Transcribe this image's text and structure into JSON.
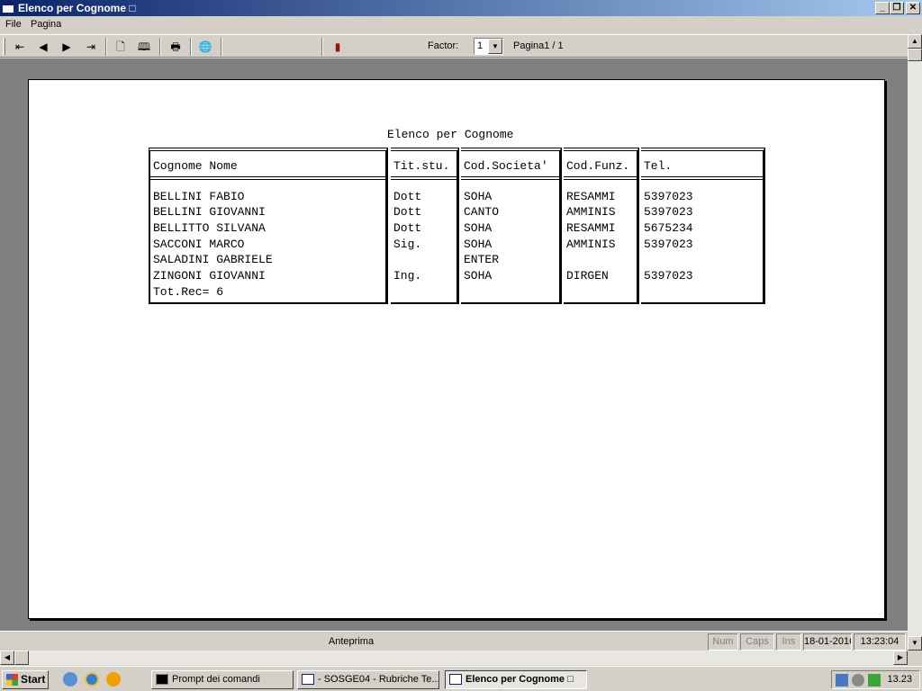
{
  "window": {
    "title": "Elenco per Cognome □"
  },
  "menu": [
    "File",
    "Pagina"
  ],
  "toolbar": {
    "factor_label": "Factor:",
    "factor_value": "1",
    "page_label": "Pagina1 / 1"
  },
  "report": {
    "title": "Elenco per Cognome",
    "columns": [
      "Cognome Nome",
      "Tit.stu.",
      "Cod.Societa'",
      "Cod.Funz.",
      "Tel."
    ],
    "rows": [
      [
        "BELLINI FABIO",
        "Dott",
        "SOHA",
        "RESAMMI",
        "5397023"
      ],
      [
        "BELLINI GIOVANNI",
        "Dott",
        "CANTO",
        "AMMINIS",
        "5397023"
      ],
      [
        "BELLITTO SILVANA",
        "Dott",
        "SOHA",
        "RESAMMI",
        "5675234"
      ],
      [
        "SACCONI MARCO",
        "Sig.",
        "SOHA",
        "AMMINIS",
        "5397023"
      ],
      [
        "SALADINI GABRIELE",
        "",
        "ENTER",
        "",
        ""
      ],
      [
        "ZINGONI GIOVANNI",
        "Ing.",
        "SOHA",
        "DIRGEN",
        "5397023"
      ]
    ],
    "total": "Tot.Rec= 6"
  },
  "statusbar": {
    "text": "Anteprima",
    "num": "Num",
    "caps": "Caps",
    "ins": "Ins",
    "date": "18-01-2016",
    "time": "13:23:04"
  },
  "taskbar": {
    "start": "Start",
    "tasks": [
      "Prompt dei comandi",
      "- SOSGE04 - Rubriche Te...",
      "Elenco per Cognome □"
    ],
    "clock": "13.23"
  },
  "colors": {
    "titlebar": "#0a246a",
    "face": "#d4d0c8",
    "preview_bg": "#808080"
  }
}
